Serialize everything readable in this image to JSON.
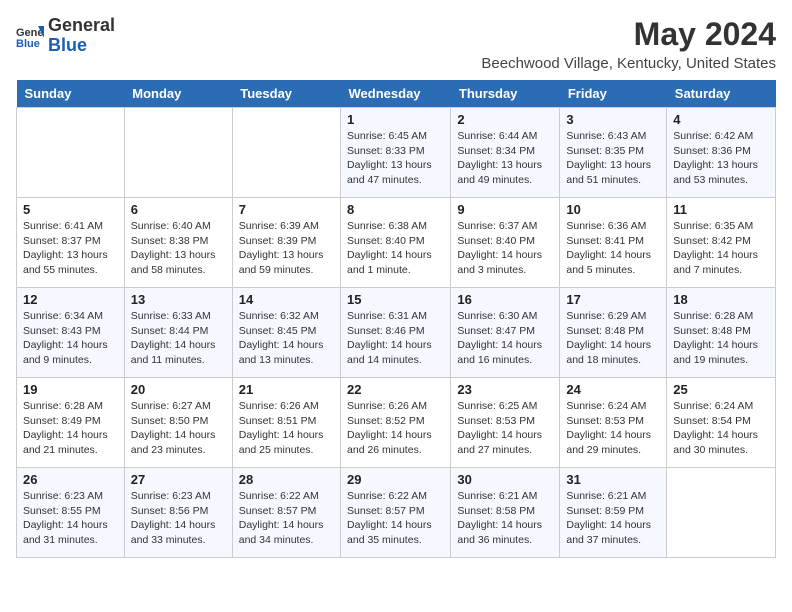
{
  "header": {
    "logo_general": "General",
    "logo_blue": "Blue",
    "title": "May 2024",
    "subtitle": "Beechwood Village, Kentucky, United States"
  },
  "days_of_week": [
    "Sunday",
    "Monday",
    "Tuesday",
    "Wednesday",
    "Thursday",
    "Friday",
    "Saturday"
  ],
  "weeks": [
    [
      {
        "day": "",
        "info": ""
      },
      {
        "day": "",
        "info": ""
      },
      {
        "day": "",
        "info": ""
      },
      {
        "day": "1",
        "info": "Sunrise: 6:45 AM\nSunset: 8:33 PM\nDaylight: 13 hours and 47 minutes."
      },
      {
        "day": "2",
        "info": "Sunrise: 6:44 AM\nSunset: 8:34 PM\nDaylight: 13 hours and 49 minutes."
      },
      {
        "day": "3",
        "info": "Sunrise: 6:43 AM\nSunset: 8:35 PM\nDaylight: 13 hours and 51 minutes."
      },
      {
        "day": "4",
        "info": "Sunrise: 6:42 AM\nSunset: 8:36 PM\nDaylight: 13 hours and 53 minutes."
      }
    ],
    [
      {
        "day": "5",
        "info": "Sunrise: 6:41 AM\nSunset: 8:37 PM\nDaylight: 13 hours and 55 minutes."
      },
      {
        "day": "6",
        "info": "Sunrise: 6:40 AM\nSunset: 8:38 PM\nDaylight: 13 hours and 58 minutes."
      },
      {
        "day": "7",
        "info": "Sunrise: 6:39 AM\nSunset: 8:39 PM\nDaylight: 13 hours and 59 minutes."
      },
      {
        "day": "8",
        "info": "Sunrise: 6:38 AM\nSunset: 8:40 PM\nDaylight: 14 hours and 1 minute."
      },
      {
        "day": "9",
        "info": "Sunrise: 6:37 AM\nSunset: 8:40 PM\nDaylight: 14 hours and 3 minutes."
      },
      {
        "day": "10",
        "info": "Sunrise: 6:36 AM\nSunset: 8:41 PM\nDaylight: 14 hours and 5 minutes."
      },
      {
        "day": "11",
        "info": "Sunrise: 6:35 AM\nSunset: 8:42 PM\nDaylight: 14 hours and 7 minutes."
      }
    ],
    [
      {
        "day": "12",
        "info": "Sunrise: 6:34 AM\nSunset: 8:43 PM\nDaylight: 14 hours and 9 minutes."
      },
      {
        "day": "13",
        "info": "Sunrise: 6:33 AM\nSunset: 8:44 PM\nDaylight: 14 hours and 11 minutes."
      },
      {
        "day": "14",
        "info": "Sunrise: 6:32 AM\nSunset: 8:45 PM\nDaylight: 14 hours and 13 minutes."
      },
      {
        "day": "15",
        "info": "Sunrise: 6:31 AM\nSunset: 8:46 PM\nDaylight: 14 hours and 14 minutes."
      },
      {
        "day": "16",
        "info": "Sunrise: 6:30 AM\nSunset: 8:47 PM\nDaylight: 14 hours and 16 minutes."
      },
      {
        "day": "17",
        "info": "Sunrise: 6:29 AM\nSunset: 8:48 PM\nDaylight: 14 hours and 18 minutes."
      },
      {
        "day": "18",
        "info": "Sunrise: 6:28 AM\nSunset: 8:48 PM\nDaylight: 14 hours and 19 minutes."
      }
    ],
    [
      {
        "day": "19",
        "info": "Sunrise: 6:28 AM\nSunset: 8:49 PM\nDaylight: 14 hours and 21 minutes."
      },
      {
        "day": "20",
        "info": "Sunrise: 6:27 AM\nSunset: 8:50 PM\nDaylight: 14 hours and 23 minutes."
      },
      {
        "day": "21",
        "info": "Sunrise: 6:26 AM\nSunset: 8:51 PM\nDaylight: 14 hours and 25 minutes."
      },
      {
        "day": "22",
        "info": "Sunrise: 6:26 AM\nSunset: 8:52 PM\nDaylight: 14 hours and 26 minutes."
      },
      {
        "day": "23",
        "info": "Sunrise: 6:25 AM\nSunset: 8:53 PM\nDaylight: 14 hours and 27 minutes."
      },
      {
        "day": "24",
        "info": "Sunrise: 6:24 AM\nSunset: 8:53 PM\nDaylight: 14 hours and 29 minutes."
      },
      {
        "day": "25",
        "info": "Sunrise: 6:24 AM\nSunset: 8:54 PM\nDaylight: 14 hours and 30 minutes."
      }
    ],
    [
      {
        "day": "26",
        "info": "Sunrise: 6:23 AM\nSunset: 8:55 PM\nDaylight: 14 hours and 31 minutes."
      },
      {
        "day": "27",
        "info": "Sunrise: 6:23 AM\nSunset: 8:56 PM\nDaylight: 14 hours and 33 minutes."
      },
      {
        "day": "28",
        "info": "Sunrise: 6:22 AM\nSunset: 8:57 PM\nDaylight: 14 hours and 34 minutes."
      },
      {
        "day": "29",
        "info": "Sunrise: 6:22 AM\nSunset: 8:57 PM\nDaylight: 14 hours and 35 minutes."
      },
      {
        "day": "30",
        "info": "Sunrise: 6:21 AM\nSunset: 8:58 PM\nDaylight: 14 hours and 36 minutes."
      },
      {
        "day": "31",
        "info": "Sunrise: 6:21 AM\nSunset: 8:59 PM\nDaylight: 14 hours and 37 minutes."
      },
      {
        "day": "",
        "info": ""
      }
    ]
  ]
}
